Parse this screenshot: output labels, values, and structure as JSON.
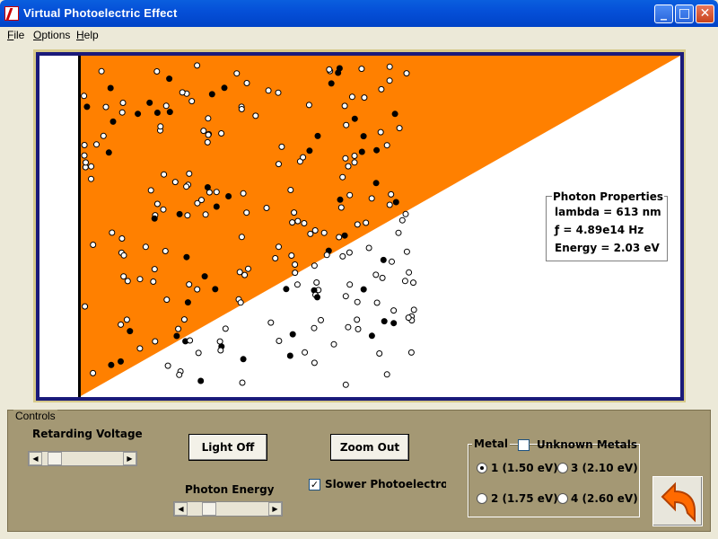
{
  "window": {
    "title": "Virtual Photoelectric Effect"
  },
  "window_controls": {
    "minimize": "_",
    "maximize": "□",
    "close": "✕"
  },
  "menu": {
    "items": [
      "File",
      "Options",
      "Help"
    ]
  },
  "photon_properties": {
    "legend": "Photon Properties",
    "lambda": "lambda = 613 nm",
    "frequency": "ƒ = 4.89e14 Hz",
    "energy": "Energy =  2.03 eV"
  },
  "controls": {
    "legend": "Controls",
    "retarding_voltage_label": "Retarding Voltage",
    "light_button": "Light Off",
    "zoom_button": "Zoom Out",
    "photon_energy_label": "Photon Energy",
    "slower_checkbox_label": "Slower Photoelectrons",
    "slower_checked": true
  },
  "metal": {
    "legend": "Metal",
    "unknown_label": "Unknown Metals",
    "unknown_checked": false,
    "options": [
      {
        "label": "1 (1.50 eV)",
        "selected": true
      },
      {
        "label": "2 (1.75 eV)",
        "selected": false
      },
      {
        "label": "3 (2.10 eV)",
        "selected": false
      },
      {
        "label": "4 (2.60 eV)",
        "selected": false
      }
    ]
  },
  "colors": {
    "light_beam": "#ff8000",
    "frame": "#1a1a7a",
    "controls_bg": "#a49874"
  }
}
